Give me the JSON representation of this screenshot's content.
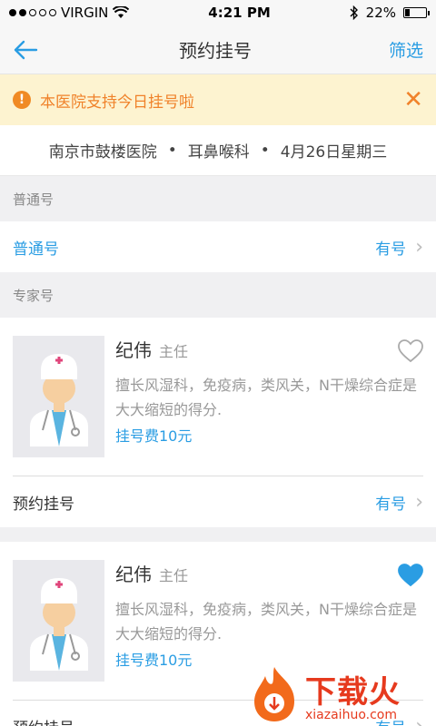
{
  "status_bar": {
    "carrier": "VIRGIN",
    "time": "4:21 PM",
    "battery": "22%",
    "battery_level": 0.22
  },
  "nav": {
    "title": "预约挂号",
    "action": "筛选"
  },
  "notice": {
    "text": "本医院支持今日挂号啦"
  },
  "info": {
    "hospital": "南京市鼓楼医院",
    "department": "耳鼻喉科",
    "date": "4月26日星期三",
    "sep": "•"
  },
  "general": {
    "section": "普通号",
    "label": "普通号",
    "status": "有号"
  },
  "expert": {
    "section": "专家号",
    "doctors": [
      {
        "name": "纪伟",
        "title": "主任",
        "desc": "擅长风湿科，免疫病，类风关，N干燥综合症是大大缩短的得分.",
        "fee": "挂号费10元",
        "book_label": "预约挂号",
        "status": "有号",
        "favorited": false
      },
      {
        "name": "纪伟",
        "title": "主任",
        "desc": "擅长风湿科，免疫病，类风关，N干燥综合症是大大缩短的得分.",
        "fee": "挂号费10元",
        "book_label": "预约挂号",
        "status": "有号",
        "favorited": true
      }
    ]
  },
  "watermark": {
    "cn": "下载火",
    "en": "xiazaihuo.com"
  },
  "colors": {
    "accent": "#2a9de3",
    "warning": "#f0822a",
    "notice_bg": "#fdf3d0"
  }
}
